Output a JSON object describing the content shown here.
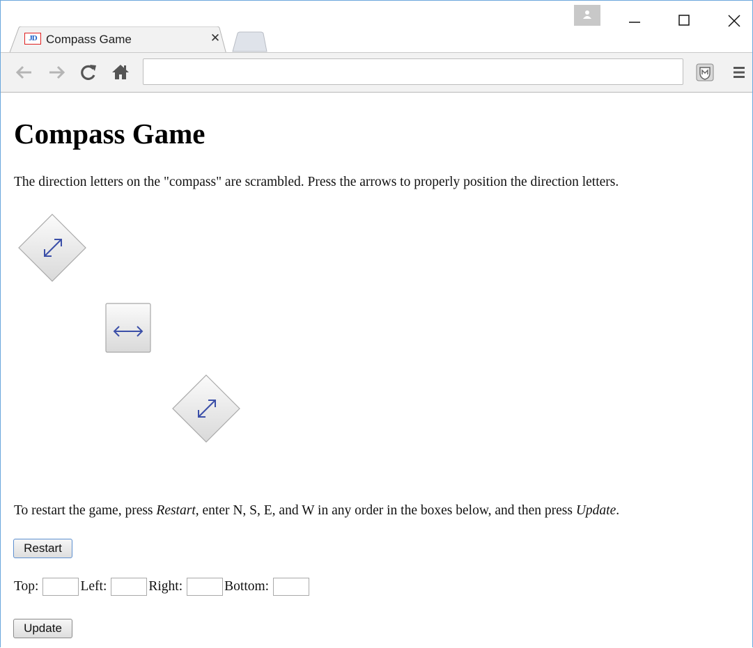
{
  "browser": {
    "tab": {
      "favicon_text": "JD",
      "title": "Compass Game"
    },
    "address": {
      "value": ""
    },
    "colors": {
      "frame_border": "#6aa6dc",
      "toolbar": "#f2f2f2"
    }
  },
  "page": {
    "title": "Compass Game",
    "intro": "The direction letters on the \"compass\" are scrambled. Press the arrows to properly position the direction letters.",
    "arrows": [
      {
        "name": "diagonal-arrow-top-left",
        "glyph": "⤢"
      },
      {
        "name": "horizontal-arrow-middle",
        "glyph": "↔"
      },
      {
        "name": "diagonal-arrow-bottom",
        "glyph": "⤢"
      }
    ],
    "restart_text": {
      "part1": "To restart the game, press ",
      "restart_word": "Restart",
      "part2": ", enter N, S, E, and W in any order in the boxes below, and then press ",
      "update_word": "Update",
      "part3": "."
    },
    "restart_button": "Restart",
    "fields": {
      "top_label": "Top:",
      "top_value": "",
      "left_label": "Left:",
      "left_value": "",
      "right_label": "Right:",
      "right_value": "",
      "bottom_label": "Bottom:",
      "bottom_value": ""
    },
    "update_button": "Update",
    "arrow_color": "#3b4fa8"
  }
}
